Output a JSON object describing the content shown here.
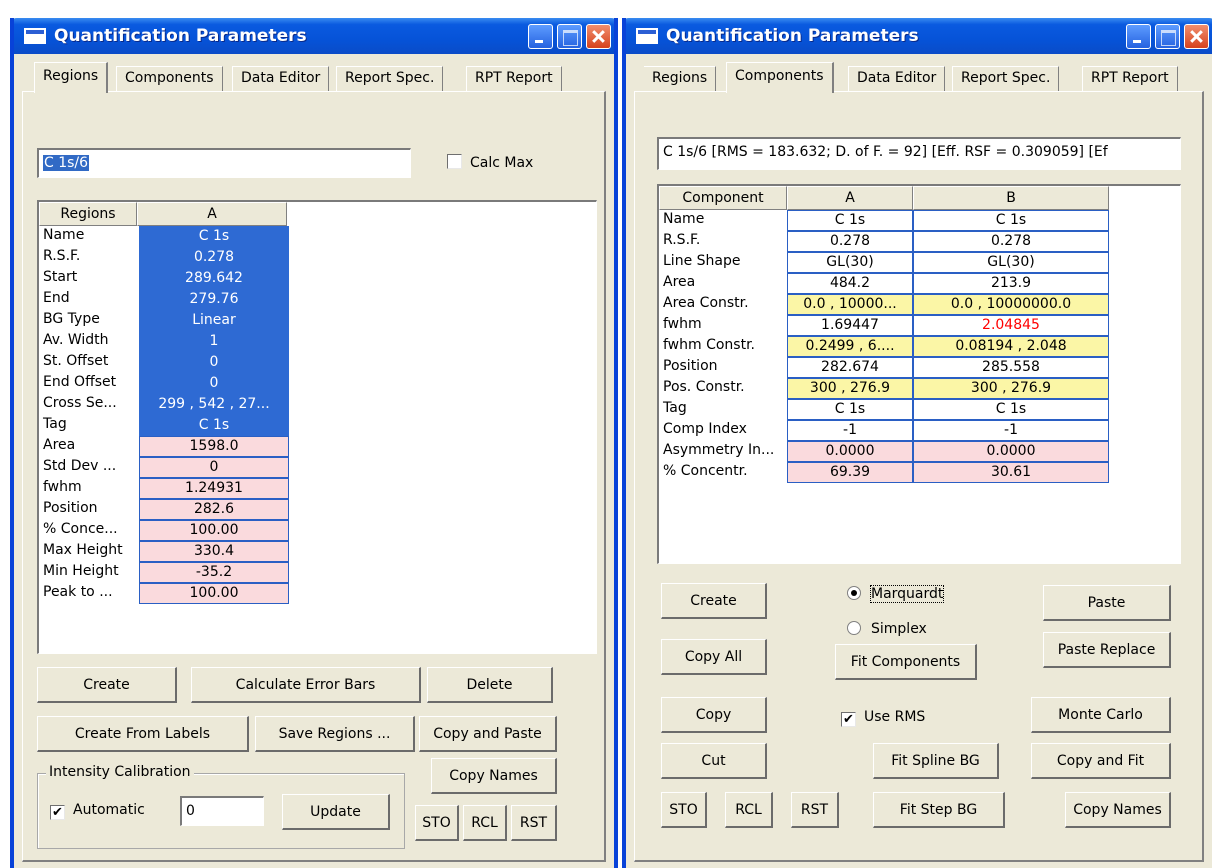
{
  "colors": {
    "title_bar": "#0653d8",
    "selected_cell": "#2e6ad3",
    "result_cell": "#fadadd",
    "constraint_cell": "#fbf6a6",
    "warning_text": "#ff0000"
  },
  "left": {
    "title": "Quantification Parameters",
    "tabs": [
      "Regions",
      "Components",
      "Data Editor",
      "Report Spec.",
      "RPT Report"
    ],
    "active_tab": "Regions",
    "name_field": "C 1s/6",
    "calc_max_label": "Calc Max",
    "calc_max_checked": false,
    "grid_headers": [
      "Regions",
      "A"
    ],
    "rows": [
      {
        "label": "Name",
        "value": "C 1s",
        "style": "blue"
      },
      {
        "label": "R.S.F.",
        "value": "0.278",
        "style": "blue"
      },
      {
        "label": "Start",
        "value": "289.642",
        "style": "blue"
      },
      {
        "label": "End",
        "value": "279.76",
        "style": "blue"
      },
      {
        "label": "BG Type",
        "value": "Linear",
        "style": "blue"
      },
      {
        "label": "Av. Width",
        "value": "1",
        "style": "blue"
      },
      {
        "label": "St. Offset",
        "value": "0",
        "style": "blue"
      },
      {
        "label": "End Offset",
        "value": "0",
        "style": "blue"
      },
      {
        "label": "Cross Se...",
        "value": "299 , 542 , 27...",
        "style": "blue"
      },
      {
        "label": "Tag",
        "value": "C 1s",
        "style": "blue"
      },
      {
        "label": "Area",
        "value": "1598.0",
        "style": "pink"
      },
      {
        "label": "Std Dev ...",
        "value": "0",
        "style": "pink"
      },
      {
        "label": "fwhm",
        "value": "1.24931",
        "style": "pink"
      },
      {
        "label": "Position",
        "value": "282.6",
        "style": "pink"
      },
      {
        "label": "% Conce...",
        "value": "100.00",
        "style": "pink"
      },
      {
        "label": "Max Height",
        "value": "330.4",
        "style": "pink"
      },
      {
        "label": "Min Height",
        "value": "-35.2",
        "style": "pink"
      },
      {
        "label": "Peak to ...",
        "value": "100.00",
        "style": "pink"
      }
    ],
    "buttons": {
      "create": "Create",
      "calc_error_bars": "Calculate Error Bars",
      "delete": "Delete",
      "create_from_labels": "Create From Labels",
      "save_regions": "Save Regions ...",
      "copy_and_paste": "Copy and Paste",
      "copy_names": "Copy Names",
      "update": "Update",
      "sto": "STO",
      "rcl": "RCL",
      "rst": "RST"
    },
    "intensity_group_label": "Intensity Calibration",
    "automatic_label": "Automatic",
    "automatic_checked": true,
    "calibration_value": "0"
  },
  "right": {
    "title": "Quantification Parameters",
    "tabs": [
      "Regions",
      "Components",
      "Data Editor",
      "Report Spec.",
      "RPT Report"
    ],
    "active_tab": "Components",
    "info_field": "C 1s/6 [RMS = 183.632; D. of F. = 92] [Eff. RSF = 0.309059] [Ef",
    "grid_headers": [
      "Component",
      "A",
      "B"
    ],
    "rows": [
      {
        "label": "Name",
        "a": "C 1s",
        "b": "C 1s",
        "style": "white"
      },
      {
        "label": "R.S.F.",
        "a": "0.278",
        "b": "0.278",
        "style": "white"
      },
      {
        "label": "Line Shape",
        "a": "GL(30)",
        "b": "GL(30)",
        "style": "white"
      },
      {
        "label": "Area",
        "a": "484.2",
        "b": "213.9",
        "style": "white"
      },
      {
        "label": "Area Constr.",
        "a": "0.0 , 10000...",
        "b": "0.0 , 10000000.0",
        "style": "yellow"
      },
      {
        "label": "fwhm",
        "a": "1.69447",
        "b": "2.04845",
        "style": "white",
        "b_red": true
      },
      {
        "label": "fwhm Constr.",
        "a": "0.2499 , 6....",
        "b": "0.08194 , 2.048",
        "style": "yellow"
      },
      {
        "label": "Position",
        "a": "282.674",
        "b": "285.558",
        "style": "white"
      },
      {
        "label": "Pos. Constr.",
        "a": "300 , 276.9",
        "b": "300 , 276.9",
        "style": "yellow"
      },
      {
        "label": "Tag",
        "a": "C 1s",
        "b": "C 1s",
        "style": "white"
      },
      {
        "label": "Comp Index",
        "a": "-1",
        "b": "-1",
        "style": "white"
      },
      {
        "label": "Asymmetry In...",
        "a": "0.0000",
        "b": "0.0000",
        "style": "pink"
      },
      {
        "label": "% Concentr.",
        "a": "69.39",
        "b": "30.61",
        "style": "pink"
      }
    ],
    "buttons": {
      "create": "Create",
      "copy_all": "Copy All",
      "copy": "Copy",
      "cut": "Cut",
      "sto": "STO",
      "rcl": "RCL",
      "rst": "RST",
      "fit_components": "Fit Components",
      "fit_spline_bg": "Fit Spline BG",
      "fit_step_bg": "Fit Step BG",
      "paste": "Paste",
      "paste_replace": "Paste Replace",
      "monte_carlo": "Monte Carlo",
      "copy_and_fit": "Copy and Fit",
      "copy_names": "Copy Names"
    },
    "marquardt_label": "Marquardt",
    "simplex_label": "Simplex",
    "fit_method": "Marquardt",
    "use_rms_label": "Use RMS",
    "use_rms_checked": true
  }
}
